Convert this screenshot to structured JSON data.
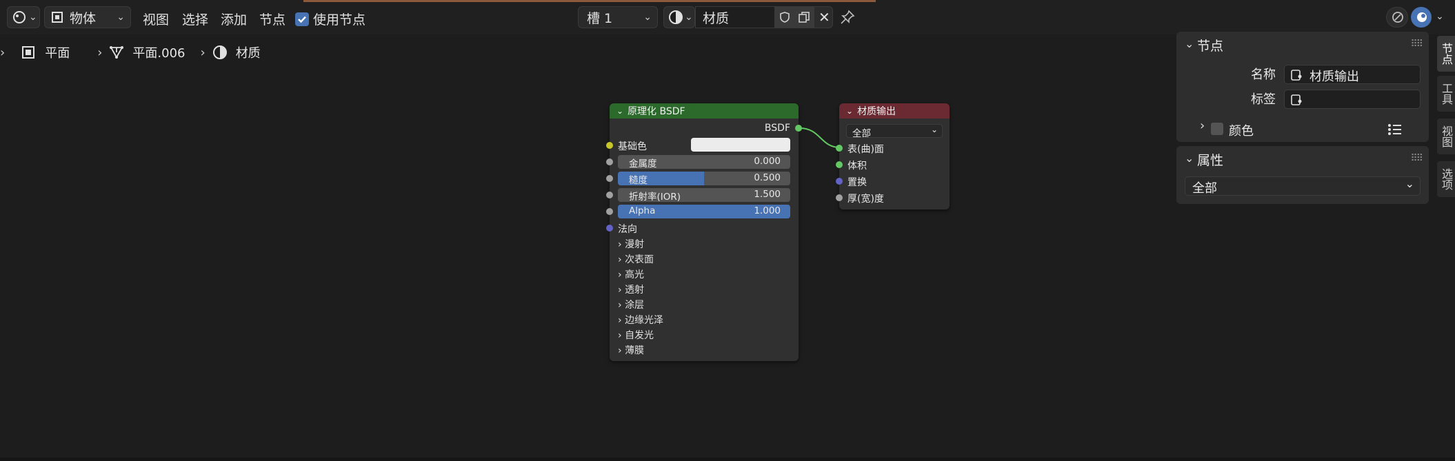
{
  "header": {
    "mode": "物体",
    "menus": [
      "视图",
      "选择",
      "添加",
      "节点"
    ],
    "use_nodes_label": "使用节点",
    "use_nodes_checked": true,
    "slot": "槽 1",
    "material_name": "材质"
  },
  "breadcrumb": {
    "object": "平面",
    "mesh": "平面.006",
    "material": "材质"
  },
  "bsdf_node": {
    "title": "原理化 BSDF",
    "header_color": "#2b6a2b",
    "output": "BSDF",
    "base_color_label": "基础色",
    "fields": [
      {
        "label": "金属度",
        "value": "0.000",
        "fill": 0.0
      },
      {
        "label": "糙度",
        "value": "0.500",
        "fill": 0.5
      },
      {
        "label": "折射率(IOR)",
        "value": "1.500",
        "fill": 0.0
      },
      {
        "label": "Alpha",
        "value": "1.000",
        "fill": 1.0
      }
    ],
    "normal_label": "法向",
    "panels": [
      "漫射",
      "次表面",
      "高光",
      "透射",
      "涂层",
      "边缘光泽",
      "自发光",
      "薄膜"
    ]
  },
  "output_node": {
    "title": "材质输出",
    "header_color": "#6b2a32",
    "target": "全部",
    "inputs": [
      "表(曲)面",
      "体积",
      "置换",
      "厚(宽)度"
    ]
  },
  "sidebar": {
    "node_panel": {
      "title": "节点",
      "name_label": "名称",
      "name_value": "材质输出",
      "label_label": "标签",
      "label_value": "",
      "color_label": "颜色"
    },
    "properties_panel": {
      "title": "属性",
      "target_value": "全部"
    },
    "tabs": [
      "节点",
      "工具",
      "视图",
      "选项"
    ]
  },
  "colors": {
    "socket_yellow": "#c7c729",
    "socket_gray": "#a1a1a1",
    "socket_purple": "#6363c7",
    "socket_green": "#63c763",
    "link_green": "#63c763",
    "accent_blue": "#4772b3"
  }
}
